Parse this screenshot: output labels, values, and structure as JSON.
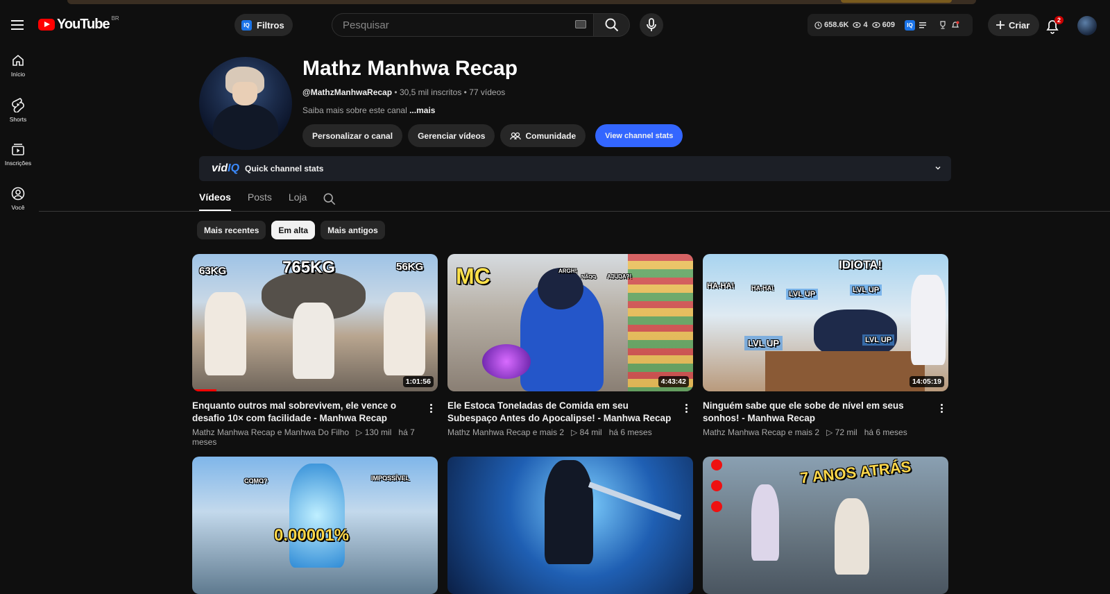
{
  "header": {
    "logo_text": "YouTube",
    "country_code": "BR",
    "filters_label": "Filtros",
    "search_placeholder": "Pesquisar",
    "vidiq_stats": {
      "views": "658.6K",
      "stat2": "4",
      "stat3": "609"
    },
    "create_label": "Criar",
    "notification_count": "2"
  },
  "sidebar": {
    "items": [
      {
        "label": "Início",
        "icon": "home-icon"
      },
      {
        "label": "Shorts",
        "icon": "shorts-icon"
      },
      {
        "label": "Inscrições",
        "icon": "subscriptions-icon"
      },
      {
        "label": "Você",
        "icon": "you-icon"
      }
    ]
  },
  "channel": {
    "name": "Mathz Manhwa Recap",
    "handle": "@MathzManhwaRecap",
    "subscribers": "30,5 mil inscritos",
    "videos_count": "77 vídeos",
    "separator": "•",
    "description": "Saiba mais sobre este canal",
    "more": "...mais",
    "actions": {
      "customize": "Personalizar o canal",
      "manage": "Gerenciar vídeos",
      "community": "Comunidade",
      "stats": "View channel stats"
    }
  },
  "vidiq_bar": {
    "logo_main": "vid",
    "logo_accent": "IQ",
    "label": "Quick channel stats"
  },
  "tabs": [
    {
      "label": "Vídeos",
      "active": true
    },
    {
      "label": "Posts",
      "active": false
    },
    {
      "label": "Loja",
      "active": false
    }
  ],
  "chips": [
    {
      "label": "Mais recentes",
      "selected": false
    },
    {
      "label": "Em alta",
      "selected": true
    },
    {
      "label": "Mais antigos",
      "selected": false
    }
  ],
  "videos": [
    {
      "title": "Enquanto outros mal sobrevivem, ele vence o desafio 10× com facilidade - Manhwa Recap",
      "channel": "Mathz Manhwa Recap e Manhwa Do Filho",
      "views": "▷ 130 mil",
      "age": "há 7 meses",
      "duration": "1:01:56",
      "thumb_text": [
        "765KG",
        "63KG",
        "56KG"
      ],
      "watched_fraction": 0.1
    },
    {
      "title": "Ele Estoca Toneladas de Comida em seu Subespaço Antes do Apocalipse! - Manhwa Recap",
      "channel": "Mathz Manhwa Recap e mais 2",
      "views": "▷ 84 mil",
      "age": "há 6 meses",
      "duration": "4:43:42",
      "thumb_text": [
        "MC",
        "ARGH!",
        "NÃOO",
        "AJUDA?!"
      ]
    },
    {
      "title": "Ninguém sabe que ele sobe de nível em seus sonhos! - Manhwa Recap",
      "channel": "Mathz Manhwa Recap e mais 2",
      "views": "▷ 72 mil",
      "age": "há 6 meses",
      "duration": "14:05:19",
      "thumb_text": [
        "IDIOTA!",
        "HA-HA!",
        "HA-HA!",
        "LVL UP",
        "LVL UP",
        "LVL UP",
        "LVL UP"
      ]
    },
    {
      "thumb_text": [
        "0.00001%",
        "COMO?",
        "IMPOSSÍVEL"
      ]
    },
    {
      "thumb_text": []
    },
    {
      "thumb_text": [
        "7 ANOS ATRÁS"
      ]
    }
  ]
}
